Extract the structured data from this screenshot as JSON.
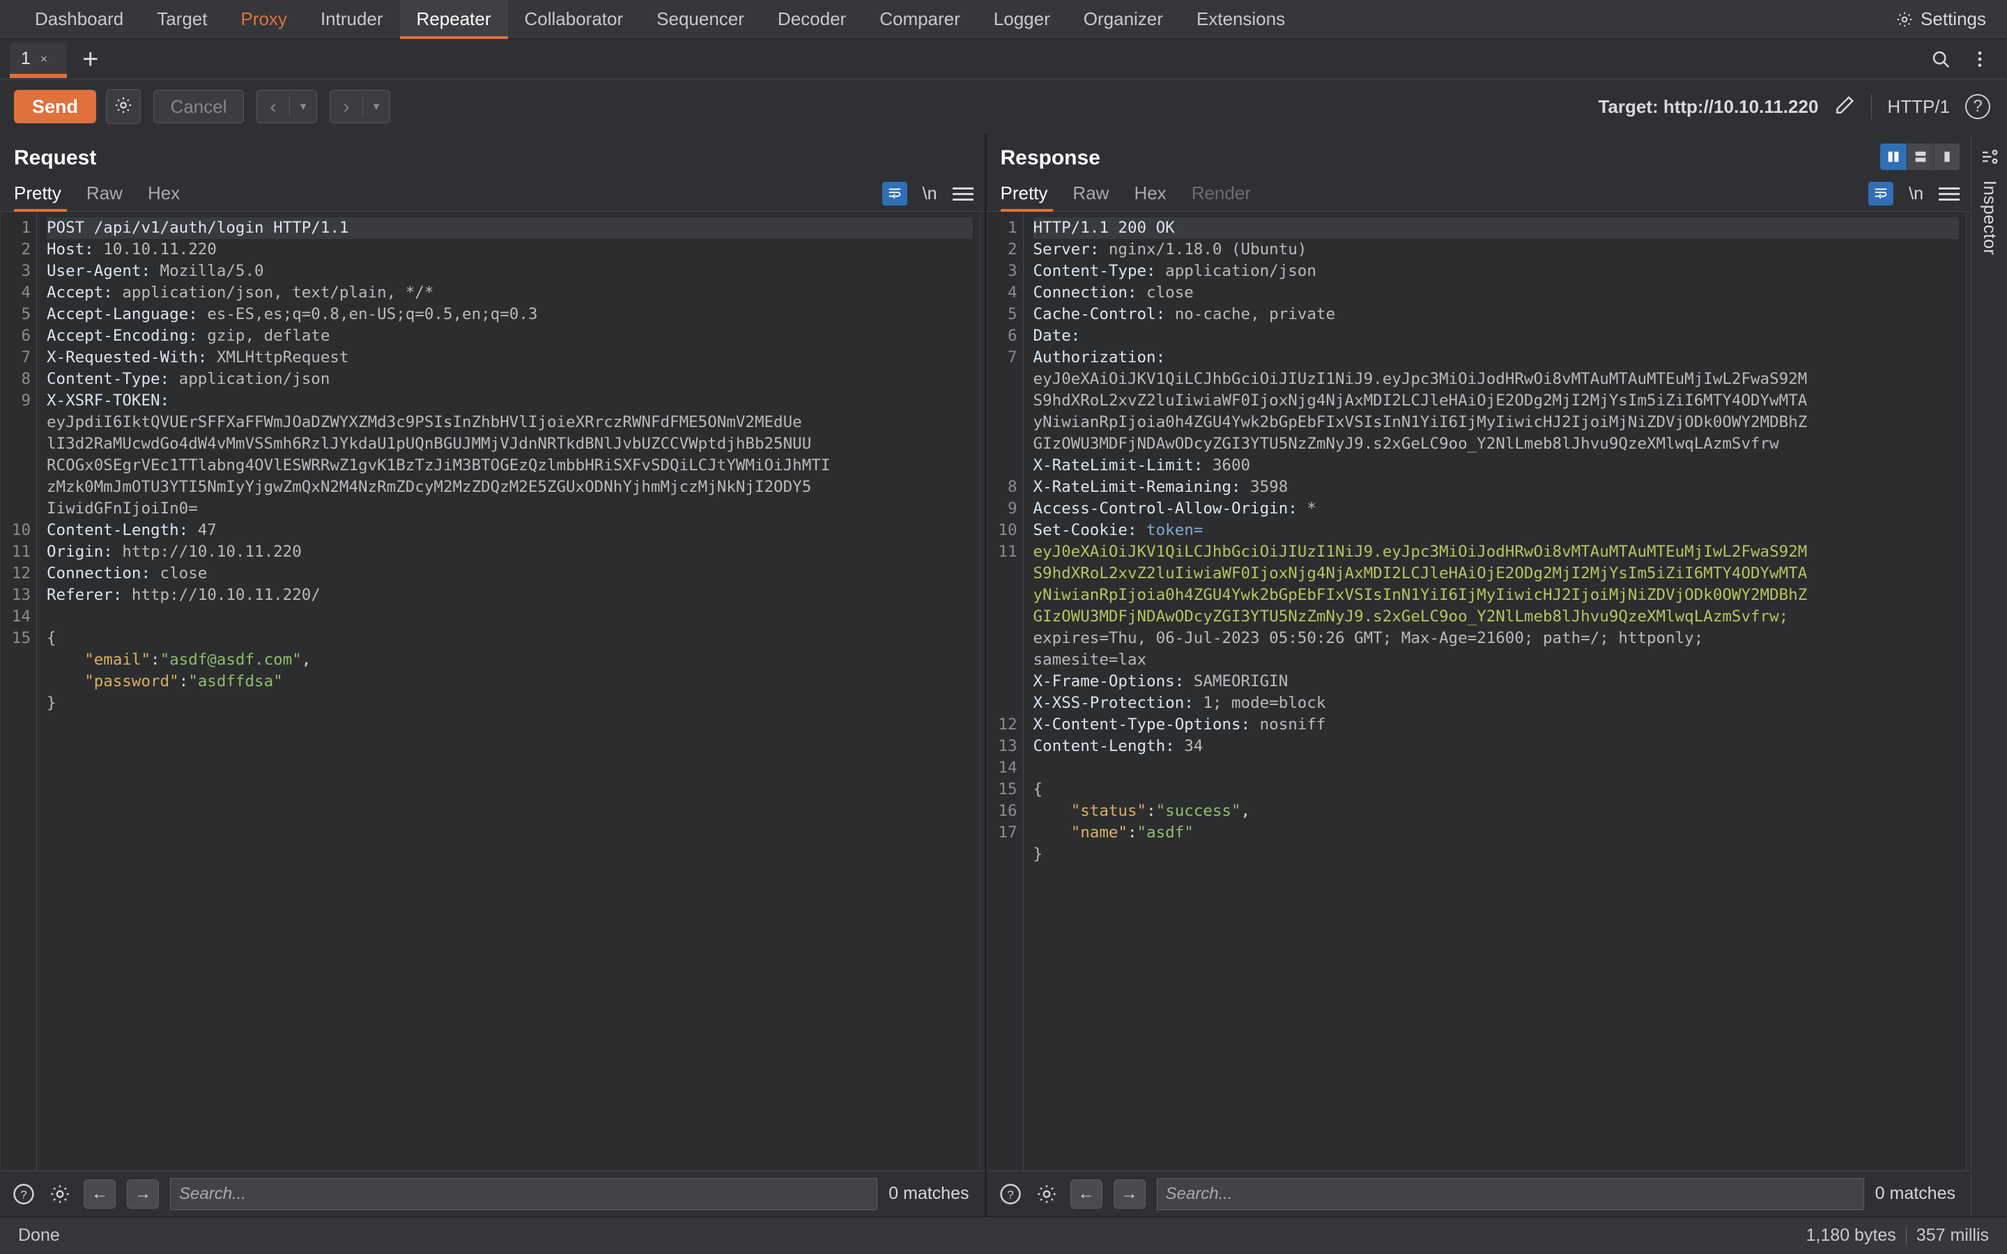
{
  "topnav": {
    "items": [
      {
        "label": "Dashboard",
        "state": "normal"
      },
      {
        "label": "Target",
        "state": "normal"
      },
      {
        "label": "Proxy",
        "state": "accent"
      },
      {
        "label": "Intruder",
        "state": "normal"
      },
      {
        "label": "Repeater",
        "state": "active"
      },
      {
        "label": "Collaborator",
        "state": "normal"
      },
      {
        "label": "Sequencer",
        "state": "normal"
      },
      {
        "label": "Decoder",
        "state": "normal"
      },
      {
        "label": "Comparer",
        "state": "normal"
      },
      {
        "label": "Logger",
        "state": "normal"
      },
      {
        "label": "Organizer",
        "state": "normal"
      },
      {
        "label": "Extensions",
        "state": "normal"
      }
    ],
    "settings_label": "Settings",
    "settings_icon": "gear-icon"
  },
  "tabstrip": {
    "tab_label": "1",
    "tab_close": "×",
    "add_label": "+",
    "search_icon": "search-icon",
    "menu_icon": "vertical-dots-icon"
  },
  "toolbar": {
    "send_label": "Send",
    "gear_icon": "gear-icon",
    "cancel_label": "Cancel",
    "back_arrow": "‹",
    "back_caret": "▾",
    "forward_arrow": "›",
    "forward_caret": "▾",
    "target_label": "Target: http://10.10.11.220",
    "edit_icon": "pencil-icon",
    "http_version": "HTTP/1",
    "help_label": "?"
  },
  "request": {
    "title": "Request",
    "tabs": [
      {
        "label": "Pretty",
        "state": "active"
      },
      {
        "label": "Raw",
        "state": "normal"
      },
      {
        "label": "Hex",
        "state": "normal"
      }
    ],
    "wrap_icon": "word-wrap-icon",
    "newline_label": "\\n",
    "menu_icon": "hamburger-icon",
    "line_numbers": [
      "1",
      "2",
      "3",
      "4",
      "5",
      "6",
      "7",
      "8",
      "9",
      "",
      "",
      "",
      "",
      "",
      "10",
      "11",
      "12",
      "13",
      "14",
      "15",
      "",
      "",
      ""
    ],
    "lines": [
      {
        "type": "start",
        "text": "POST /api/v1/auth/login HTTP/1.1"
      },
      {
        "type": "header",
        "name": "Host:",
        "value": " 10.10.11.220"
      },
      {
        "type": "header",
        "name": "User-Agent:",
        "value": " Mozilla/5.0"
      },
      {
        "type": "header",
        "name": "Accept:",
        "value": " application/json, text/plain, */*"
      },
      {
        "type": "header",
        "name": "Accept-Language:",
        "value": " es-ES,es;q=0.8,en-US;q=0.5,en;q=0.3"
      },
      {
        "type": "header",
        "name": "Accept-Encoding:",
        "value": " gzip, deflate"
      },
      {
        "type": "header",
        "name": "X-Requested-With:",
        "value": " XMLHttpRequest"
      },
      {
        "type": "header",
        "name": "Content-Type:",
        "value": " application/json"
      },
      {
        "type": "header",
        "name": "X-XSRF-TOKEN:",
        "value": ""
      },
      {
        "type": "cont",
        "text": "eyJpdiI6IktQVUErSFFXaFFWmJOaDZWYXZMd3c9PSIsInZhbHVlIjoieXRrczRWNFdFME5ONmV2MEdUe"
      },
      {
        "type": "cont",
        "text": "lI3d2RaMUcwdGo4dW4vMmVSSmh6RzlJYkdaU1pUQnBGUJMMjVJdnNRTkdBNlJvbUZCCVWptdjhBb25NUU"
      },
      {
        "type": "cont",
        "text": "RCOGx0SEgrVEc1TTlabng4OVlESWRRwZ1gvK1BzTzJiM3BTOGEzQzlmbbHRiSXFvSDQiLCJtYWMiOiJhMTI"
      },
      {
        "type": "cont",
        "text": "zMzk0MmJmOTU3YTI5NmIyYjgwZmQxN2M4NzRmZDcyM2MzZDQzM2E5ZGUxODNhYjhmMjczMjNkNjI2ODY5"
      },
      {
        "type": "cont",
        "text": "IiwidGFnIjoiIn0="
      },
      {
        "type": "header",
        "name": "Content-Length:",
        "value": " 47"
      },
      {
        "type": "header",
        "name": "Origin:",
        "value": " http://10.10.11.220"
      },
      {
        "type": "header",
        "name": "Connection:",
        "value": " close"
      },
      {
        "type": "header",
        "name": "Referer:",
        "value": " http://10.10.11.220/"
      },
      {
        "type": "blank",
        "text": ""
      },
      {
        "type": "plain",
        "text": "{"
      },
      {
        "type": "json",
        "indent": "    ",
        "key": "\"email\"",
        "sep": ":",
        "value": "\"asdf@asdf.com\"",
        "tail": ","
      },
      {
        "type": "json",
        "indent": "    ",
        "key": "\"password\"",
        "sep": ":",
        "value": "\"asdffdsa\"",
        "tail": ""
      },
      {
        "type": "plain",
        "text": "}"
      }
    ],
    "search_help_icon": "help-icon",
    "search_gear_icon": "gear-icon",
    "search_prev_icon": "arrow-left-icon",
    "search_next_icon": "arrow-right-icon",
    "search_placeholder": "Search...",
    "matches_label": "0 matches"
  },
  "response": {
    "title": "Response",
    "tabs": [
      {
        "label": "Pretty",
        "state": "active"
      },
      {
        "label": "Raw",
        "state": "normal"
      },
      {
        "label": "Hex",
        "state": "normal"
      },
      {
        "label": "Render",
        "state": "disabled"
      }
    ],
    "layout_buttons": [
      {
        "name": "split-vertical-icon",
        "selected": true
      },
      {
        "name": "split-horizontal-icon",
        "selected": false
      },
      {
        "name": "single-pane-icon",
        "selected": false
      }
    ],
    "wrap_icon": "word-wrap-icon",
    "newline_label": "\\n",
    "menu_icon": "hamburger-icon",
    "line_numbers": [
      "1",
      "2",
      "3",
      "4",
      "5",
      "6",
      "7",
      "",
      "",
      "",
      "",
      "",
      "8",
      "9",
      "10",
      "11",
      "",
      "",
      "",
      "",
      "",
      "",
      "",
      "12",
      "13",
      "14",
      "15",
      "16",
      "17",
      "",
      "",
      ""
    ],
    "lines": [
      {
        "type": "start",
        "text": "HTTP/1.1 200 OK"
      },
      {
        "type": "header",
        "name": "Server:",
        "value": " nginx/1.18.0 (Ubuntu)"
      },
      {
        "type": "header",
        "name": "Content-Type:",
        "value": " application/json"
      },
      {
        "type": "header",
        "name": "Connection:",
        "value": " close"
      },
      {
        "type": "header",
        "name": "Cache-Control:",
        "value": " no-cache, private"
      },
      {
        "type": "header",
        "name": "Date:",
        "value": ""
      },
      {
        "type": "header",
        "name": "Authorization:",
        "value": ""
      },
      {
        "type": "cont",
        "text": "eyJ0eXAiOiJKV1QiLCJhbGciOiJIUzI1NiJ9.eyJpc3MiOiJodHRwOi8vMTAuMTAuMTEuMjIwL2FwaS92M"
      },
      {
        "type": "cont",
        "text": "S9hdXRoL2xvZ2luIiwiaWF0IjoxNjg4NjAxMDI2LCJleHAiOjE2ODg2MjI2MjYsIm5iZiI6MTY4ODYwMTA"
      },
      {
        "type": "cont",
        "text": "yNiwianRpIjoia0h4ZGU4Ywk2bGpEbFIxVSIsInN1YiI6IjMyIiwicHJ2IjoiMjNiZDVjODk0OWY2MDBhZ"
      },
      {
        "type": "cont",
        "text": "GIzOWU3MDFjNDAwODcyZGI3YTU5NzZmNyJ9.s2xGeLC9oo_Y2NlLmeb8lJhvu9QzeXMlwqLAzmSvfrw"
      },
      {
        "type": "header",
        "name": "X-RateLimit-Limit:",
        "value": " 3600"
      },
      {
        "type": "header",
        "name": "X-RateLimit-Remaining:",
        "value": " 3598"
      },
      {
        "type": "header",
        "name": "Access-Control-Allow-Origin:",
        "value": " *"
      },
      {
        "type": "setcookie",
        "name": "Set-Cookie:",
        "value": " token=",
        "tokenline": ""
      },
      {
        "type": "cookie",
        "text": "eyJ0eXAiOiJKV1QiLCJhbGciOiJIUzI1NiJ9.eyJpc3MiOiJodHRwOi8vMTAuMTAuMTEuMjIwL2FwaS92M"
      },
      {
        "type": "cookie",
        "text": "S9hdXRoL2xvZ2luIiwiaWF0IjoxNjg4NjAxMDI2LCJleHAiOjE2ODg2MjI2MjYsIm5iZiI6MTY4ODYwMTA"
      },
      {
        "type": "cookie",
        "text": "yNiwianRpIjoia0h4ZGU4Ywk2bGpEbFIxVSIsInN1YiI6IjMyIiwicHJ2IjoiMjNiZDVjODk0OWY2MDBhZ"
      },
      {
        "type": "cookie",
        "text": "GIzOWU3MDFjNDAwODcyZGI3YTU5NzZmNyJ9.s2xGeLC9oo_Y2NlLmeb8lJhvu9QzeXMlwqLAzmSvfrw;"
      },
      {
        "type": "cont",
        "text": "expires=Thu, 06-Jul-2023 05:50:26 GMT; Max-Age=21600; path=/; httponly;"
      },
      {
        "type": "cont",
        "text": "samesite=lax"
      },
      {
        "type": "header",
        "name": "X-Frame-Options:",
        "value": " SAMEORIGIN"
      },
      {
        "type": "header",
        "name": "X-XSS-Protection:",
        "value": " 1; mode=block"
      },
      {
        "type": "header",
        "name": "X-Content-Type-Options:",
        "value": " nosniff"
      },
      {
        "type": "header",
        "name": "Content-Length:",
        "value": " 34"
      },
      {
        "type": "blank",
        "text": ""
      },
      {
        "type": "plain",
        "text": "{"
      },
      {
        "type": "json",
        "indent": "    ",
        "key": "\"status\"",
        "sep": ":",
        "value": "\"success\"",
        "tail": ","
      },
      {
        "type": "json",
        "indent": "    ",
        "key": "\"name\"",
        "sep": ":",
        "value": "\"asdf\"",
        "tail": ""
      },
      {
        "type": "plain",
        "text": "}"
      }
    ],
    "search_help_icon": "help-icon",
    "search_gear_icon": "gear-icon",
    "search_prev_icon": "arrow-left-icon",
    "search_next_icon": "arrow-right-icon",
    "search_placeholder": "Search...",
    "matches_label": "0 matches"
  },
  "inspector": {
    "label": "Inspector",
    "icon": "inspector-icon"
  },
  "statusbar": {
    "status": "Done",
    "bytes": "1,180 bytes",
    "time": "357 millis"
  },
  "colors": {
    "accent": "#e0703c",
    "selected_blue": "#2f6fb5",
    "background": "#2f3033",
    "editor_bg": "#2c2d2f",
    "header_name": "#d9e5ef",
    "json_key": "#d9b060",
    "json_value": "#90bd6d",
    "cookie_token": "#b9c35c"
  }
}
